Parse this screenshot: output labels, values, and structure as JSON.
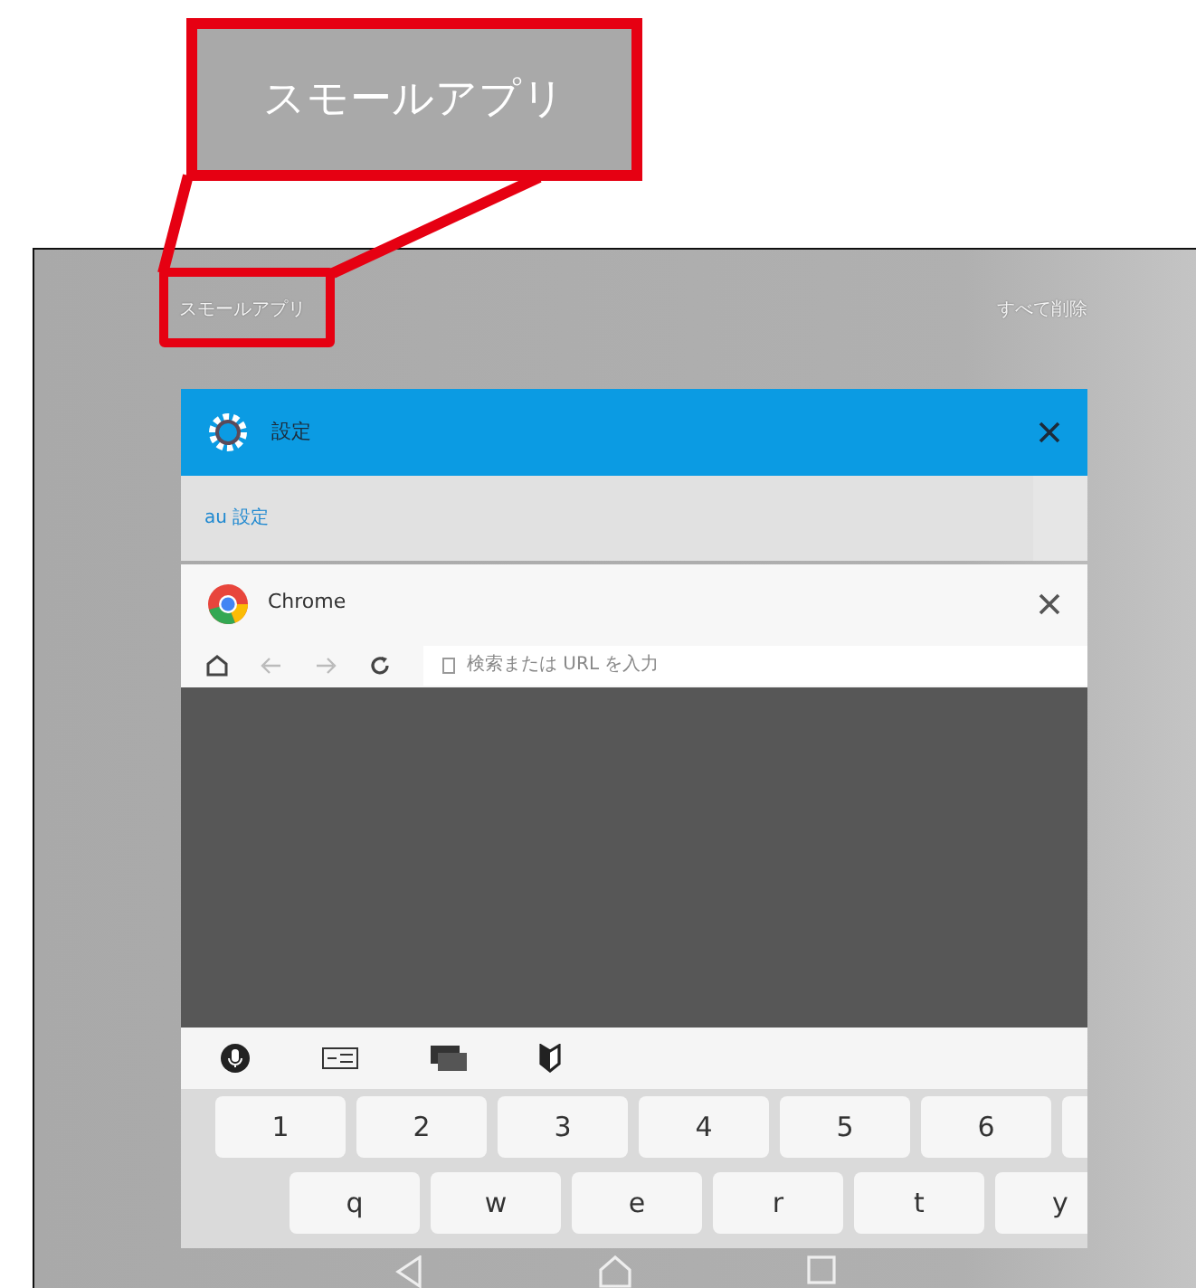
{
  "annotation": {
    "callout_label": "スモールアプリ"
  },
  "recents": {
    "title": "スモールアプリ",
    "clear_all": "すべて削除"
  },
  "cards": [
    {
      "kind": "settings",
      "app_name": "設定",
      "item": "au 設定"
    },
    {
      "kind": "browser",
      "app_name": "Chrome",
      "address_placeholder": "検索または URL を入力",
      "number_keys": [
        "1",
        "2",
        "3",
        "4",
        "5",
        "6"
      ],
      "letter_keys": [
        "q",
        "w",
        "e",
        "r",
        "t",
        "y"
      ]
    }
  ]
}
